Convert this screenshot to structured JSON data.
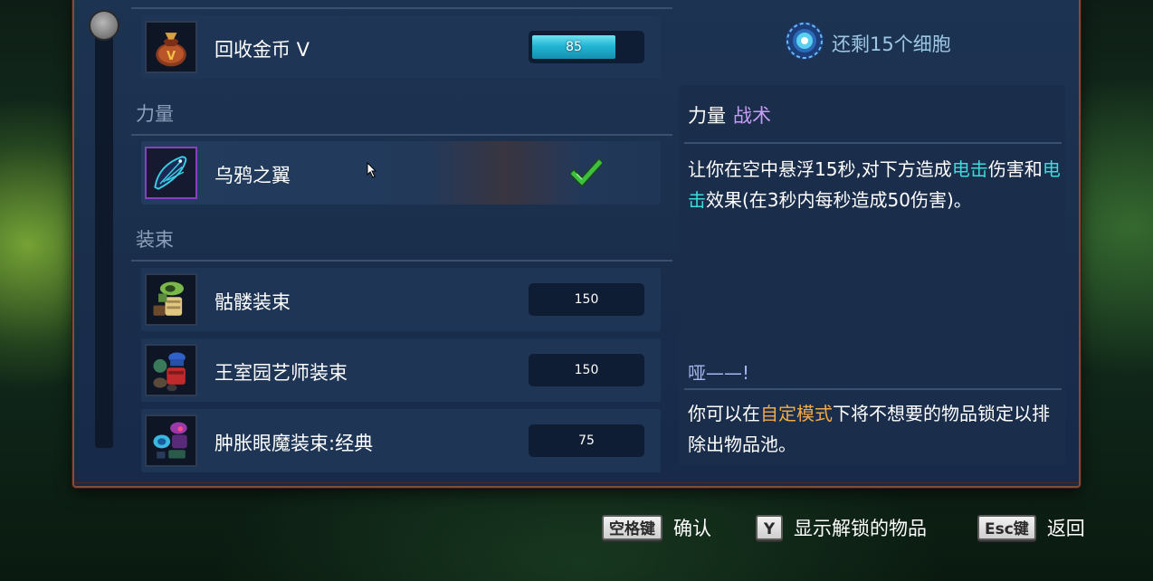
{
  "cells": {
    "icon": "cell-icon",
    "text": "还剩15个细胞"
  },
  "list": {
    "top_item": {
      "name": "回收金币 V",
      "progress_text": "85",
      "progress_fraction": 0.77,
      "icon": "gold-bag-icon"
    },
    "sections": [
      {
        "header": "力量",
        "items": [
          {
            "name": "乌鸦之翼",
            "icon": "crow-wing-icon",
            "state": "unlocked",
            "selected": true
          }
        ]
      },
      {
        "header": "装束",
        "items": [
          {
            "name": "骷髅装束",
            "cost": "150",
            "icon": "skeleton-outfit-icon"
          },
          {
            "name": "王室园艺师装束",
            "cost": "150",
            "icon": "gardener-outfit-icon"
          },
          {
            "name": "肿胀眼魔装束:经典",
            "cost": "75",
            "icon": "bloated-eye-outfit-icon"
          }
        ]
      }
    ]
  },
  "details": {
    "category": "力量",
    "subcategory": "战术",
    "description": {
      "p1": "让你在空中悬浮15秒,对下方造成",
      "hl1": "电击",
      "p2": "伤害和",
      "hl2": "电击",
      "p3": "效果(在3秒内每秒造成50伤害)。"
    },
    "tip_label": "哑——!",
    "tip": {
      "p1": "你可以在",
      "hl": "自定模式",
      "p2": "下将不想要的物品锁定以排除出物品池。"
    }
  },
  "hints": [
    {
      "key": "空格键",
      "label": "确认"
    },
    {
      "key": "Y",
      "label": "显示解锁的物品"
    },
    {
      "key": "Esc键",
      "label": "返回"
    }
  ],
  "colors": {
    "panel_bg": "#1d3352",
    "panel_border": "#8a4a32",
    "highlight_cyan": "#3fd9d9",
    "highlight_orange": "#f2a94a",
    "subcategory_purple": "#c49ef2",
    "progress_fill": "#23b5d3",
    "check_green": "#3fbf3f"
  }
}
